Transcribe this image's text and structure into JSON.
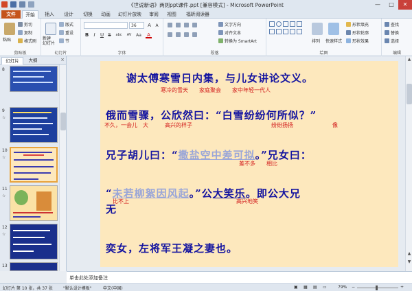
{
  "window": {
    "title": "《世说新语》两则ppt课件.ppt [兼容模式] - Microsoft PowerPoint",
    "minimize": "—",
    "maximize": "□",
    "close": "✕"
  },
  "tabs": [
    {
      "label": "文件"
    },
    {
      "label": "开始"
    },
    {
      "label": "插入"
    },
    {
      "label": "设计"
    },
    {
      "label": "切换"
    },
    {
      "label": "动画"
    },
    {
      "label": "幻灯片放映"
    },
    {
      "label": "审阅"
    },
    {
      "label": "视图"
    },
    {
      "label": "福昕阅读器"
    }
  ],
  "ribbon": {
    "clipboard": {
      "label": "剪贴板",
      "paste": "粘贴",
      "cut": "剪切",
      "copy": "复制",
      "format_painter": "格式刷"
    },
    "slides": {
      "label": "幻灯片",
      "new_slide": "新建\n幻灯片",
      "layout": "版式",
      "reset": "重设",
      "section": "节"
    },
    "font": {
      "label": "字体",
      "size": "36",
      "bold": "B",
      "italic": "I",
      "underline": "U",
      "strike": "S",
      "shadow": "abc",
      "spacing": "AV",
      "case": "Aa",
      "font_color": "A"
    },
    "paragraph": {
      "label": "段落",
      "text_direction": "文字方向",
      "align_text": "对齐文本",
      "smartart": "转换为 SmartArt"
    },
    "drawing": {
      "label": "绘图",
      "arrange": "排列",
      "quick_styles": "快速样式",
      "shape_fill": "形状填充",
      "shape_outline": "形状轮廓",
      "shape_effects": "形状效果"
    },
    "editing": {
      "label": "编辑",
      "find": "查找",
      "replace": "替换",
      "select": "选择"
    }
  },
  "left_pane": {
    "tabs": [
      "幻灯片",
      "大纲"
    ],
    "close": "×",
    "thumbnails": [
      {
        "num": "8",
        "selected": false
      },
      {
        "num": "9",
        "selected": false
      },
      {
        "num": "10",
        "selected": true
      },
      {
        "num": "11",
        "selected": false
      },
      {
        "num": "12",
        "selected": false
      },
      {
        "num": "13",
        "selected": false
      }
    ]
  },
  "slide": {
    "line1": "谢太傅寒雪日内集，与儿女讲论文义。",
    "ann1": "寒冷的雪天　　家庭聚会　　家中年轻一代人",
    "line2": "俄而雪骤，公欣然曰：“白雪纷纷何所似？”",
    "ann2a": "不久，一会儿　大　　　高兴的样子",
    "ann2b": "纷纷扬扬",
    "ann2c": "像",
    "line3_pre": "兄子胡儿曰：“",
    "line3_ghost": "撒盐空中差可拟",
    "line3_post": "。”兄女曰：",
    "ann3": "差不多　　相比",
    "line4_pre": "“",
    "line4_ghost": "未若柳絮因风起",
    "line4_mid": "。”公",
    "line4_ul": "大笑乐",
    "line4_post": "。即公大兄",
    "ann4a": "比不上",
    "ann4b": "高兴地笑",
    "line5": "无",
    "line6": "奕女，左将军王凝之妻也。"
  },
  "notes": {
    "placeholder": "单击此处添加备注"
  },
  "status": {
    "slide_info": "幻灯片 第 10 张，共 37 张",
    "theme": "\"默认设计模板\"",
    "language": "中文(中国)",
    "zoom": "79%",
    "zoom_fraction": 0.79
  },
  "colors": {
    "slide_bg": "#fde8bd",
    "text_blue": "#1414a0",
    "annotation_red": "#d21b1b",
    "file_tab": "#c5531a",
    "selected_thumb": "#e8a33c"
  }
}
